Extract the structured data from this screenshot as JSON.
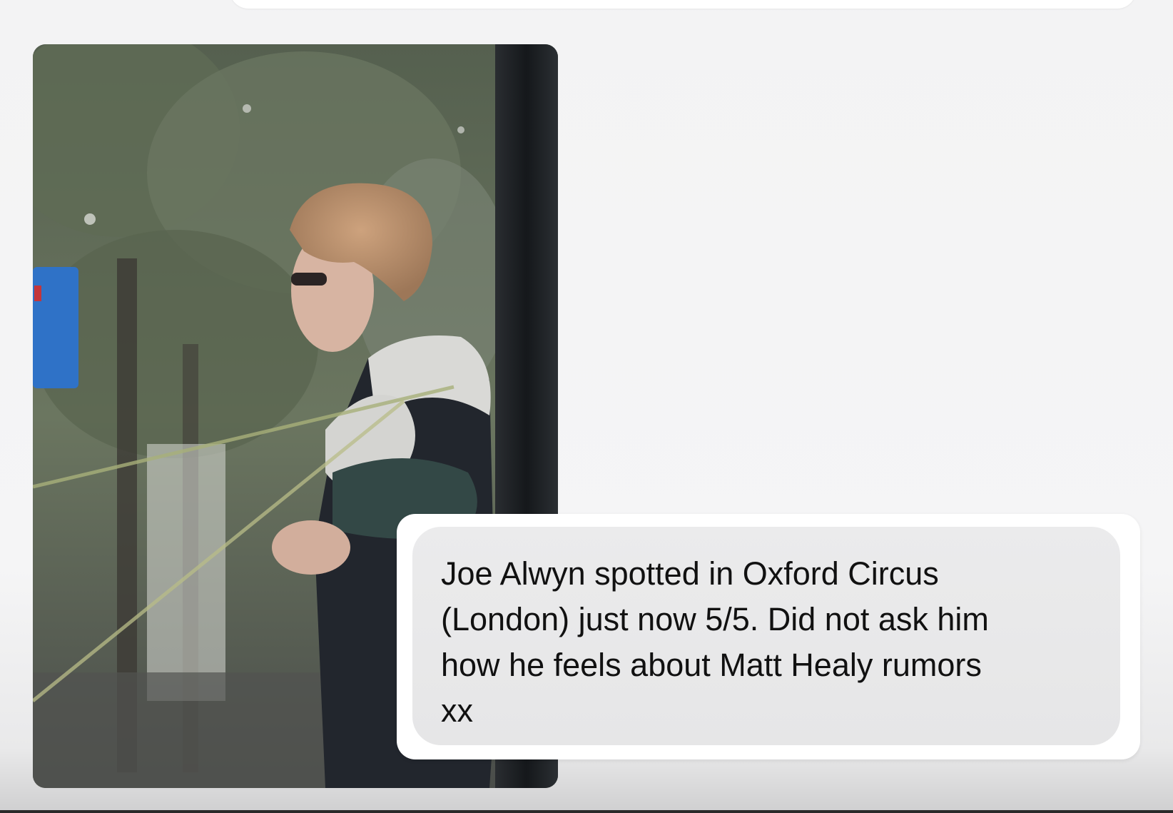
{
  "message": {
    "text": "Joe Alwyn spotted in Oxford Circus\n(London) just now 5/5. Did not ask him\nhow he feels about Matt Healy rumors\nxx"
  },
  "photo": {
    "icon": "photo-attachment"
  },
  "colors": {
    "background": "#f4f4f5",
    "bubble_outer": "#ffffff",
    "bubble_inner": "#e9e9ea",
    "text": "#111111"
  }
}
